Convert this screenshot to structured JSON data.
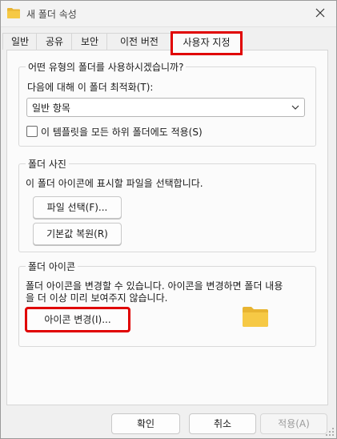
{
  "window": {
    "title": "새 폴더 속성",
    "title_icon": "folder-icon",
    "close_icon": "close-icon"
  },
  "tabs": [
    {
      "label": "일반",
      "active": false
    },
    {
      "label": "공유",
      "active": false
    },
    {
      "label": "보안",
      "active": false
    },
    {
      "label": "이전 버전",
      "active": false
    },
    {
      "label": "사용자 지정",
      "active": true
    }
  ],
  "optimize_group": {
    "title": "어떤 유형의 폴더를 사용하시겠습니까?",
    "optimize_label": "다음에 대해 이 폴더 최적화(T):",
    "optimize_value": "일반 항목",
    "apply_template_label": "이 템플릿을 모든 하위 폴더에도 적용(S)",
    "apply_template_checked": false
  },
  "picture_group": {
    "title": "폴더 사진",
    "description": "이 폴더 아이콘에 표시할 파일을 선택합니다.",
    "choose_file_button": "파일 선택(F)...",
    "restore_default_button": "기본값 복원(R)"
  },
  "icon_group": {
    "title": "폴더 아이콘",
    "description_line1": "폴더 아이콘을 변경할 수 있습니다. 아이콘을 변경하면 폴더 내용",
    "description_line2": "을 더 이상  미리 보여주지 않습니다.",
    "change_icon_button": "아이콘 변경(I)...",
    "preview_icon": "folder-icon"
  },
  "footer": {
    "ok_button": "확인",
    "cancel_button": "취소",
    "apply_button": "적용(A)",
    "apply_enabled": false
  },
  "colors": {
    "highlight": "#e00000",
    "folder_yellow": "#f6c945"
  }
}
